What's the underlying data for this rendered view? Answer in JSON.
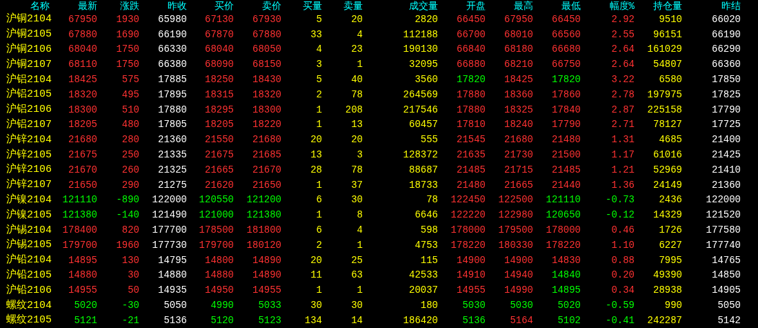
{
  "table": {
    "name_column": "名称",
    "columns": [
      "最新",
      "涨跌",
      "昨收",
      "买价",
      "卖价",
      "买量",
      "卖量",
      "成交量",
      "开盘",
      "最高",
      "最低",
      "幅度%",
      "持仓量",
      "昨结"
    ],
    "rows": [
      {
        "name": "沪铜2104",
        "cells": [
          {
            "text": "67950",
            "color": "#ff3232"
          },
          {
            "text": "1930",
            "color": "#ff3232"
          },
          {
            "text": "65980",
            "color": "#ffffff"
          },
          {
            "text": "67130",
            "color": "#ff3232"
          },
          {
            "text": "67930",
            "color": "#ff3232"
          },
          {
            "text": "5",
            "color": "#ffff00"
          },
          {
            "text": "20",
            "color": "#ffff00"
          },
          {
            "text": "2820",
            "color": "#ffff00"
          },
          {
            "text": "66450",
            "color": "#ff3232"
          },
          {
            "text": "67950",
            "color": "#ff3232"
          },
          {
            "text": "66450",
            "color": "#ff3232"
          },
          {
            "text": "2.92",
            "color": "#ff3232"
          },
          {
            "text": "9510",
            "color": "#ffff00"
          },
          {
            "text": "66020",
            "color": "#ffffff"
          }
        ]
      },
      {
        "name": "沪铜2105",
        "cells": [
          {
            "text": "67880",
            "color": "#ff3232"
          },
          {
            "text": "1690",
            "color": "#ff3232"
          },
          {
            "text": "66190",
            "color": "#ffffff"
          },
          {
            "text": "67870",
            "color": "#ff3232"
          },
          {
            "text": "67880",
            "color": "#ff3232"
          },
          {
            "text": "33",
            "color": "#ffff00"
          },
          {
            "text": "4",
            "color": "#ffff00"
          },
          {
            "text": "112188",
            "color": "#ffff00"
          },
          {
            "text": "66700",
            "color": "#ff3232"
          },
          {
            "text": "68010",
            "color": "#ff3232"
          },
          {
            "text": "66560",
            "color": "#ff3232"
          },
          {
            "text": "2.55",
            "color": "#ff3232"
          },
          {
            "text": "96151",
            "color": "#ffff00"
          },
          {
            "text": "66190",
            "color": "#ffffff"
          }
        ]
      },
      {
        "name": "沪铜2106",
        "cells": [
          {
            "text": "68040",
            "color": "#ff3232"
          },
          {
            "text": "1750",
            "color": "#ff3232"
          },
          {
            "text": "66330",
            "color": "#ffffff"
          },
          {
            "text": "68040",
            "color": "#ff3232"
          },
          {
            "text": "68050",
            "color": "#ff3232"
          },
          {
            "text": "4",
            "color": "#ffff00"
          },
          {
            "text": "23",
            "color": "#ffff00"
          },
          {
            "text": "190130",
            "color": "#ffff00"
          },
          {
            "text": "66840",
            "color": "#ff3232"
          },
          {
            "text": "68180",
            "color": "#ff3232"
          },
          {
            "text": "66680",
            "color": "#ff3232"
          },
          {
            "text": "2.64",
            "color": "#ff3232"
          },
          {
            "text": "161029",
            "color": "#ffff00"
          },
          {
            "text": "66290",
            "color": "#ffffff"
          }
        ]
      },
      {
        "name": "沪铜2107",
        "cells": [
          {
            "text": "68110",
            "color": "#ff3232"
          },
          {
            "text": "1750",
            "color": "#ff3232"
          },
          {
            "text": "66380",
            "color": "#ffffff"
          },
          {
            "text": "68090",
            "color": "#ff3232"
          },
          {
            "text": "68150",
            "color": "#ff3232"
          },
          {
            "text": "3",
            "color": "#ffff00"
          },
          {
            "text": "1",
            "color": "#ffff00"
          },
          {
            "text": "32095",
            "color": "#ffff00"
          },
          {
            "text": "66880",
            "color": "#ff3232"
          },
          {
            "text": "68210",
            "color": "#ff3232"
          },
          {
            "text": "66750",
            "color": "#ff3232"
          },
          {
            "text": "2.64",
            "color": "#ff3232"
          },
          {
            "text": "54807",
            "color": "#ffff00"
          },
          {
            "text": "66360",
            "color": "#ffffff"
          }
        ]
      },
      {
        "name": "沪铝2104",
        "cells": [
          {
            "text": "18425",
            "color": "#ff3232"
          },
          {
            "text": "575",
            "color": "#ff3232"
          },
          {
            "text": "17885",
            "color": "#ffffff"
          },
          {
            "text": "18250",
            "color": "#ff3232"
          },
          {
            "text": "18430",
            "color": "#ff3232"
          },
          {
            "text": "5",
            "color": "#ffff00"
          },
          {
            "text": "40",
            "color": "#ffff00"
          },
          {
            "text": "3560",
            "color": "#ffff00"
          },
          {
            "text": "17820",
            "color": "#00ff00"
          },
          {
            "text": "18425",
            "color": "#ff3232"
          },
          {
            "text": "17820",
            "color": "#00ff00"
          },
          {
            "text": "3.22",
            "color": "#ff3232"
          },
          {
            "text": "6580",
            "color": "#ffff00"
          },
          {
            "text": "17850",
            "color": "#ffffff"
          }
        ]
      },
      {
        "name": "沪铝2105",
        "cells": [
          {
            "text": "18320",
            "color": "#ff3232"
          },
          {
            "text": "495",
            "color": "#ff3232"
          },
          {
            "text": "17895",
            "color": "#ffffff"
          },
          {
            "text": "18315",
            "color": "#ff3232"
          },
          {
            "text": "18320",
            "color": "#ff3232"
          },
          {
            "text": "2",
            "color": "#ffff00"
          },
          {
            "text": "78",
            "color": "#ffff00"
          },
          {
            "text": "264569",
            "color": "#ffff00"
          },
          {
            "text": "17880",
            "color": "#ff3232"
          },
          {
            "text": "18360",
            "color": "#ff3232"
          },
          {
            "text": "17860",
            "color": "#ff3232"
          },
          {
            "text": "2.78",
            "color": "#ff3232"
          },
          {
            "text": "197975",
            "color": "#ffff00"
          },
          {
            "text": "17825",
            "color": "#ffffff"
          }
        ]
      },
      {
        "name": "沪铝2106",
        "cells": [
          {
            "text": "18300",
            "color": "#ff3232"
          },
          {
            "text": "510",
            "color": "#ff3232"
          },
          {
            "text": "17880",
            "color": "#ffffff"
          },
          {
            "text": "18295",
            "color": "#ff3232"
          },
          {
            "text": "18300",
            "color": "#ff3232"
          },
          {
            "text": "1",
            "color": "#ffff00"
          },
          {
            "text": "208",
            "color": "#ffff00"
          },
          {
            "text": "217546",
            "color": "#ffff00"
          },
          {
            "text": "17880",
            "color": "#ff3232"
          },
          {
            "text": "18325",
            "color": "#ff3232"
          },
          {
            "text": "17840",
            "color": "#ff3232"
          },
          {
            "text": "2.87",
            "color": "#ff3232"
          },
          {
            "text": "225158",
            "color": "#ffff00"
          },
          {
            "text": "17790",
            "color": "#ffffff"
          }
        ]
      },
      {
        "name": "沪铝2107",
        "cells": [
          {
            "text": "18205",
            "color": "#ff3232"
          },
          {
            "text": "480",
            "color": "#ff3232"
          },
          {
            "text": "17805",
            "color": "#ffffff"
          },
          {
            "text": "18205",
            "color": "#ff3232"
          },
          {
            "text": "18220",
            "color": "#ff3232"
          },
          {
            "text": "1",
            "color": "#ffff00"
          },
          {
            "text": "13",
            "color": "#ffff00"
          },
          {
            "text": "60457",
            "color": "#ffff00"
          },
          {
            "text": "17810",
            "color": "#ff3232"
          },
          {
            "text": "18240",
            "color": "#ff3232"
          },
          {
            "text": "17790",
            "color": "#ff3232"
          },
          {
            "text": "2.71",
            "color": "#ff3232"
          },
          {
            "text": "78127",
            "color": "#ffff00"
          },
          {
            "text": "17725",
            "color": "#ffffff"
          }
        ]
      },
      {
        "name": "沪锌2104",
        "cells": [
          {
            "text": "21680",
            "color": "#ff3232"
          },
          {
            "text": "280",
            "color": "#ff3232"
          },
          {
            "text": "21360",
            "color": "#ffffff"
          },
          {
            "text": "21550",
            "color": "#ff3232"
          },
          {
            "text": "21680",
            "color": "#ff3232"
          },
          {
            "text": "20",
            "color": "#ffff00"
          },
          {
            "text": "20",
            "color": "#ffff00"
          },
          {
            "text": "555",
            "color": "#ffff00"
          },
          {
            "text": "21545",
            "color": "#ff3232"
          },
          {
            "text": "21680",
            "color": "#ff3232"
          },
          {
            "text": "21480",
            "color": "#ff3232"
          },
          {
            "text": "1.31",
            "color": "#ff3232"
          },
          {
            "text": "4685",
            "color": "#ffff00"
          },
          {
            "text": "21400",
            "color": "#ffffff"
          }
        ]
      },
      {
        "name": "沪锌2105",
        "cells": [
          {
            "text": "21675",
            "color": "#ff3232"
          },
          {
            "text": "250",
            "color": "#ff3232"
          },
          {
            "text": "21335",
            "color": "#ffffff"
          },
          {
            "text": "21675",
            "color": "#ff3232"
          },
          {
            "text": "21685",
            "color": "#ff3232"
          },
          {
            "text": "13",
            "color": "#ffff00"
          },
          {
            "text": "3",
            "color": "#ffff00"
          },
          {
            "text": "128372",
            "color": "#ffff00"
          },
          {
            "text": "21635",
            "color": "#ff3232"
          },
          {
            "text": "21730",
            "color": "#ff3232"
          },
          {
            "text": "21500",
            "color": "#ff3232"
          },
          {
            "text": "1.17",
            "color": "#ff3232"
          },
          {
            "text": "61016",
            "color": "#ffff00"
          },
          {
            "text": "21425",
            "color": "#ffffff"
          }
        ]
      },
      {
        "name": "沪锌2106",
        "cells": [
          {
            "text": "21670",
            "color": "#ff3232"
          },
          {
            "text": "260",
            "color": "#ff3232"
          },
          {
            "text": "21325",
            "color": "#ffffff"
          },
          {
            "text": "21665",
            "color": "#ff3232"
          },
          {
            "text": "21670",
            "color": "#ff3232"
          },
          {
            "text": "28",
            "color": "#ffff00"
          },
          {
            "text": "78",
            "color": "#ffff00"
          },
          {
            "text": "88687",
            "color": "#ffff00"
          },
          {
            "text": "21485",
            "color": "#ff3232"
          },
          {
            "text": "21715",
            "color": "#ff3232"
          },
          {
            "text": "21485",
            "color": "#ff3232"
          },
          {
            "text": "1.21",
            "color": "#ff3232"
          },
          {
            "text": "52969",
            "color": "#ffff00"
          },
          {
            "text": "21410",
            "color": "#ffffff"
          }
        ]
      },
      {
        "name": "沪锌2107",
        "cells": [
          {
            "text": "21650",
            "color": "#ff3232"
          },
          {
            "text": "290",
            "color": "#ff3232"
          },
          {
            "text": "21275",
            "color": "#ffffff"
          },
          {
            "text": "21620",
            "color": "#ff3232"
          },
          {
            "text": "21650",
            "color": "#ff3232"
          },
          {
            "text": "1",
            "color": "#ffff00"
          },
          {
            "text": "37",
            "color": "#ffff00"
          },
          {
            "text": "18733",
            "color": "#ffff00"
          },
          {
            "text": "21480",
            "color": "#ff3232"
          },
          {
            "text": "21665",
            "color": "#ff3232"
          },
          {
            "text": "21440",
            "color": "#ff3232"
          },
          {
            "text": "1.36",
            "color": "#ff3232"
          },
          {
            "text": "24149",
            "color": "#ffff00"
          },
          {
            "text": "21360",
            "color": "#ffffff"
          }
        ]
      },
      {
        "name": "沪镍2104",
        "cells": [
          {
            "text": "121110",
            "color": "#00ff00"
          },
          {
            "text": "-890",
            "color": "#00ff00"
          },
          {
            "text": "122000",
            "color": "#ffffff"
          },
          {
            "text": "120550",
            "color": "#00ff00"
          },
          {
            "text": "121200",
            "color": "#00ff00"
          },
          {
            "text": "6",
            "color": "#ffff00"
          },
          {
            "text": "30",
            "color": "#ffff00"
          },
          {
            "text": "78",
            "color": "#ffff00"
          },
          {
            "text": "122450",
            "color": "#ff3232"
          },
          {
            "text": "122500",
            "color": "#ff3232"
          },
          {
            "text": "121110",
            "color": "#00ff00"
          },
          {
            "text": "-0.73",
            "color": "#00ff00"
          },
          {
            "text": "2436",
            "color": "#ffff00"
          },
          {
            "text": "122000",
            "color": "#ffffff"
          }
        ]
      },
      {
        "name": "沪镍2105",
        "cells": [
          {
            "text": "121380",
            "color": "#00ff00"
          },
          {
            "text": "-140",
            "color": "#00ff00"
          },
          {
            "text": "121490",
            "color": "#ffffff"
          },
          {
            "text": "121000",
            "color": "#00ff00"
          },
          {
            "text": "121380",
            "color": "#00ff00"
          },
          {
            "text": "1",
            "color": "#ffff00"
          },
          {
            "text": "8",
            "color": "#ffff00"
          },
          {
            "text": "6646",
            "color": "#ffff00"
          },
          {
            "text": "122220",
            "color": "#ff3232"
          },
          {
            "text": "122980",
            "color": "#ff3232"
          },
          {
            "text": "120650",
            "color": "#00ff00"
          },
          {
            "text": "-0.12",
            "color": "#00ff00"
          },
          {
            "text": "14329",
            "color": "#ffff00"
          },
          {
            "text": "121520",
            "color": "#ffffff"
          }
        ]
      },
      {
        "name": "沪锡2104",
        "cells": [
          {
            "text": "178400",
            "color": "#ff3232"
          },
          {
            "text": "820",
            "color": "#ff3232"
          },
          {
            "text": "177700",
            "color": "#ffffff"
          },
          {
            "text": "178500",
            "color": "#ff3232"
          },
          {
            "text": "181800",
            "color": "#ff3232"
          },
          {
            "text": "6",
            "color": "#ffff00"
          },
          {
            "text": "4",
            "color": "#ffff00"
          },
          {
            "text": "598",
            "color": "#ffff00"
          },
          {
            "text": "178000",
            "color": "#ff3232"
          },
          {
            "text": "179500",
            "color": "#ff3232"
          },
          {
            "text": "178000",
            "color": "#ff3232"
          },
          {
            "text": "0.46",
            "color": "#ff3232"
          },
          {
            "text": "1726",
            "color": "#ffff00"
          },
          {
            "text": "177580",
            "color": "#ffffff"
          }
        ]
      },
      {
        "name": "沪锡2105",
        "cells": [
          {
            "text": "179700",
            "color": "#ff3232"
          },
          {
            "text": "1960",
            "color": "#ff3232"
          },
          {
            "text": "177730",
            "color": "#ffffff"
          },
          {
            "text": "179700",
            "color": "#ff3232"
          },
          {
            "text": "180120",
            "color": "#ff3232"
          },
          {
            "text": "2",
            "color": "#ffff00"
          },
          {
            "text": "1",
            "color": "#ffff00"
          },
          {
            "text": "4753",
            "color": "#ffff00"
          },
          {
            "text": "178220",
            "color": "#ff3232"
          },
          {
            "text": "180330",
            "color": "#ff3232"
          },
          {
            "text": "178220",
            "color": "#ff3232"
          },
          {
            "text": "1.10",
            "color": "#ff3232"
          },
          {
            "text": "6227",
            "color": "#ffff00"
          },
          {
            "text": "177740",
            "color": "#ffffff"
          }
        ]
      },
      {
        "name": "沪铅2104",
        "cells": [
          {
            "text": "14895",
            "color": "#ff3232"
          },
          {
            "text": "130",
            "color": "#ff3232"
          },
          {
            "text": "14795",
            "color": "#ffffff"
          },
          {
            "text": "14800",
            "color": "#ff3232"
          },
          {
            "text": "14890",
            "color": "#ff3232"
          },
          {
            "text": "20",
            "color": "#ffff00"
          },
          {
            "text": "25",
            "color": "#ffff00"
          },
          {
            "text": "115",
            "color": "#ffff00"
          },
          {
            "text": "14900",
            "color": "#ff3232"
          },
          {
            "text": "14900",
            "color": "#ff3232"
          },
          {
            "text": "14830",
            "color": "#ff3232"
          },
          {
            "text": "0.88",
            "color": "#ff3232"
          },
          {
            "text": "7995",
            "color": "#ffff00"
          },
          {
            "text": "14765",
            "color": "#ffffff"
          }
        ]
      },
      {
        "name": "沪铅2105",
        "cells": [
          {
            "text": "14880",
            "color": "#ff3232"
          },
          {
            "text": "30",
            "color": "#ff3232"
          },
          {
            "text": "14880",
            "color": "#ffffff"
          },
          {
            "text": "14880",
            "color": "#ff3232"
          },
          {
            "text": "14890",
            "color": "#ff3232"
          },
          {
            "text": "11",
            "color": "#ffff00"
          },
          {
            "text": "63",
            "color": "#ffff00"
          },
          {
            "text": "42533",
            "color": "#ffff00"
          },
          {
            "text": "14910",
            "color": "#ff3232"
          },
          {
            "text": "14940",
            "color": "#ff3232"
          },
          {
            "text": "14840",
            "color": "#00ff00"
          },
          {
            "text": "0.20",
            "color": "#ff3232"
          },
          {
            "text": "49390",
            "color": "#ffff00"
          },
          {
            "text": "14850",
            "color": "#ffffff"
          }
        ]
      },
      {
        "name": "沪铅2106",
        "cells": [
          {
            "text": "14955",
            "color": "#ff3232"
          },
          {
            "text": "50",
            "color": "#ff3232"
          },
          {
            "text": "14935",
            "color": "#ffffff"
          },
          {
            "text": "14950",
            "color": "#ff3232"
          },
          {
            "text": "14955",
            "color": "#ff3232"
          },
          {
            "text": "1",
            "color": "#ffff00"
          },
          {
            "text": "1",
            "color": "#ffff00"
          },
          {
            "text": "20037",
            "color": "#ffff00"
          },
          {
            "text": "14955",
            "color": "#ff3232"
          },
          {
            "text": "14990",
            "color": "#ff3232"
          },
          {
            "text": "14895",
            "color": "#00ff00"
          },
          {
            "text": "0.34",
            "color": "#ff3232"
          },
          {
            "text": "28938",
            "color": "#ffff00"
          },
          {
            "text": "14905",
            "color": "#ffffff"
          }
        ]
      },
      {
        "name": "螺纹2104",
        "cells": [
          {
            "text": "5020",
            "color": "#00ff00"
          },
          {
            "text": "-30",
            "color": "#00ff00"
          },
          {
            "text": "5050",
            "color": "#ffffff"
          },
          {
            "text": "4990",
            "color": "#00ff00"
          },
          {
            "text": "5033",
            "color": "#00ff00"
          },
          {
            "text": "30",
            "color": "#ffff00"
          },
          {
            "text": "30",
            "color": "#ffff00"
          },
          {
            "text": "180",
            "color": "#ffff00"
          },
          {
            "text": "5030",
            "color": "#00ff00"
          },
          {
            "text": "5030",
            "color": "#00ff00"
          },
          {
            "text": "5020",
            "color": "#00ff00"
          },
          {
            "text": "-0.59",
            "color": "#00ff00"
          },
          {
            "text": "990",
            "color": "#ffff00"
          },
          {
            "text": "5050",
            "color": "#ffffff"
          }
        ]
      },
      {
        "name": "螺纹2105",
        "cells": [
          {
            "text": "5121",
            "color": "#00ff00"
          },
          {
            "text": "-21",
            "color": "#00ff00"
          },
          {
            "text": "5136",
            "color": "#ffffff"
          },
          {
            "text": "5120",
            "color": "#00ff00"
          },
          {
            "text": "5123",
            "color": "#00ff00"
          },
          {
            "text": "134",
            "color": "#ffff00"
          },
          {
            "text": "14",
            "color": "#ffff00"
          },
          {
            "text": "186420",
            "color": "#ffff00"
          },
          {
            "text": "5136",
            "color": "#00ff00"
          },
          {
            "text": "5164",
            "color": "#ff3232"
          },
          {
            "text": "5102",
            "color": "#00ff00"
          },
          {
            "text": "-0.41",
            "color": "#00ff00"
          },
          {
            "text": "242287",
            "color": "#ffff00"
          },
          {
            "text": "5142",
            "color": "#ffffff"
          }
        ]
      }
    ]
  }
}
